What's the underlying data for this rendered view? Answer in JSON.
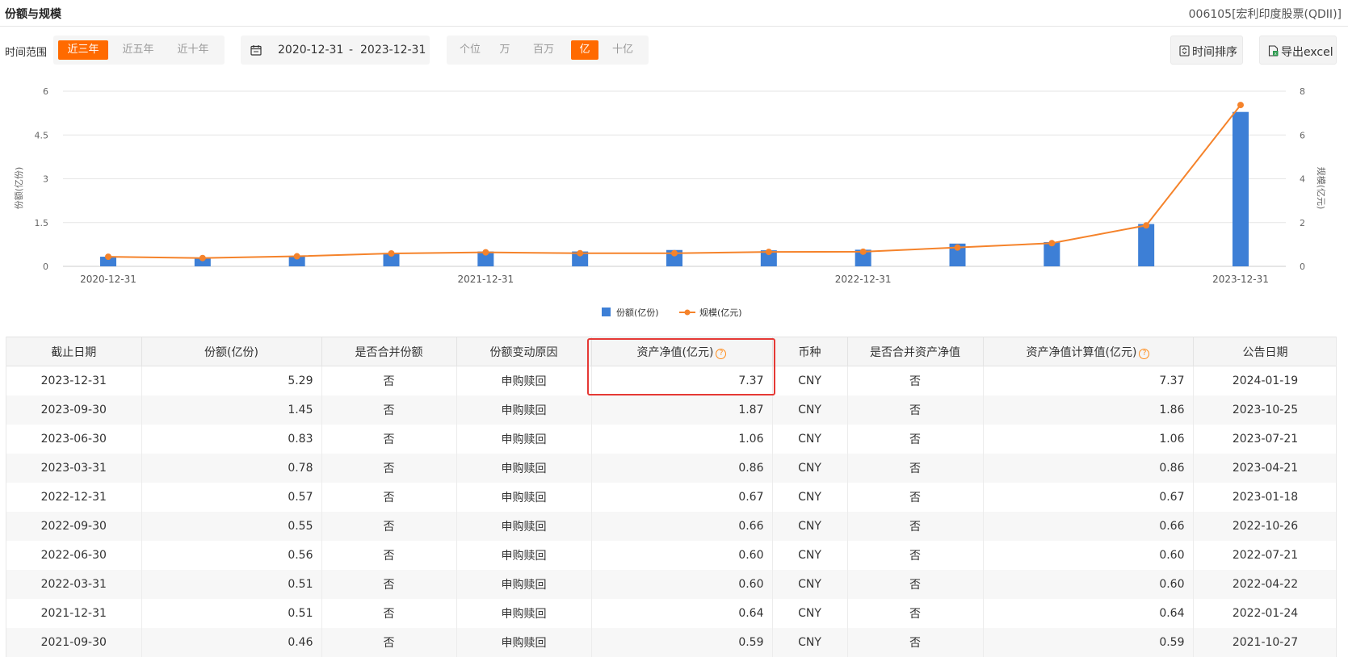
{
  "header": {
    "title": "份额与规模",
    "fund": "006105[宏利印度股票(QDII)]"
  },
  "toolbar": {
    "range_label": "时间范围",
    "range_tabs": [
      {
        "label": "近三年",
        "active": true
      },
      {
        "label": "近五年",
        "active": false
      },
      {
        "label": "近十年",
        "active": false
      }
    ],
    "date_start": "2020-12-31",
    "date_sep": "-",
    "date_end": "2023-12-31",
    "unit_tabs": [
      {
        "label": "个位",
        "active": false
      },
      {
        "label": "万",
        "active": false
      },
      {
        "label": "百万",
        "active": false
      },
      {
        "label": "亿",
        "active": true
      },
      {
        "label": "十亿",
        "active": false
      }
    ],
    "sort_label": "时间排序",
    "export_label": "导出excel",
    "accent_color": "#ff6a00"
  },
  "chart_data": {
    "type": "bar",
    "categories": [
      "2020-12-31",
      "2021-03-31",
      "2021-06-30",
      "2021-09-30",
      "2021-12-31",
      "2022-03-31",
      "2022-06-30",
      "2022-09-30",
      "2022-12-31",
      "2023-03-31",
      "2023-06-30",
      "2023-09-30",
      "2023-12-31"
    ],
    "x_tick_labels": [
      "2020-12-31",
      "2021-12-31",
      "2022-12-31",
      "2023-12-31"
    ],
    "y_left": {
      "label": "份额(亿份)",
      "range": [
        0,
        6
      ],
      "ticks": [
        "0",
        "1.5",
        "3",
        "4.5",
        "6"
      ]
    },
    "y_right": {
      "label": "规模(亿元)",
      "range": [
        0,
        8
      ],
      "ticks": [
        "0",
        "2",
        "4",
        "6",
        "8"
      ]
    },
    "series": [
      {
        "name": "份额(亿份)",
        "kind": "bar",
        "axis": "left",
        "color": "#3d7fd6",
        "values": [
          0.33,
          0.29,
          0.34,
          0.46,
          0.51,
          0.51,
          0.56,
          0.55,
          0.57,
          0.78,
          0.83,
          1.45,
          5.29
        ]
      },
      {
        "name": "规模(亿元)",
        "kind": "line",
        "axis": "right",
        "color": "#f5832b",
        "values": [
          0.44,
          0.38,
          0.46,
          0.59,
          0.64,
          0.6,
          0.6,
          0.66,
          0.67,
          0.86,
          1.06,
          1.87,
          7.37
        ]
      }
    ],
    "legend_position": "bottom",
    "grid": true
  },
  "table": {
    "columns": [
      "截止日期",
      "份额(亿份)",
      "是否合并份额",
      "份额变动原因",
      "资产净值(亿元)",
      "币种",
      "是否合并资产净值",
      "资产净值计算值(亿元)",
      "公告日期"
    ],
    "help_icon": "?",
    "rows": [
      [
        "2023-12-31",
        "5.29",
        "否",
        "申购赎回",
        "7.37",
        "CNY",
        "否",
        "7.37",
        "2024-01-19"
      ],
      [
        "2023-09-30",
        "1.45",
        "否",
        "申购赎回",
        "1.87",
        "CNY",
        "否",
        "1.86",
        "2023-10-25"
      ],
      [
        "2023-06-30",
        "0.83",
        "否",
        "申购赎回",
        "1.06",
        "CNY",
        "否",
        "1.06",
        "2023-07-21"
      ],
      [
        "2023-03-31",
        "0.78",
        "否",
        "申购赎回",
        "0.86",
        "CNY",
        "否",
        "0.86",
        "2023-04-21"
      ],
      [
        "2022-12-31",
        "0.57",
        "否",
        "申购赎回",
        "0.67",
        "CNY",
        "否",
        "0.67",
        "2023-01-18"
      ],
      [
        "2022-09-30",
        "0.55",
        "否",
        "申购赎回",
        "0.66",
        "CNY",
        "否",
        "0.66",
        "2022-10-26"
      ],
      [
        "2022-06-30",
        "0.56",
        "否",
        "申购赎回",
        "0.60",
        "CNY",
        "否",
        "0.60",
        "2022-07-21"
      ],
      [
        "2022-03-31",
        "0.51",
        "否",
        "申购赎回",
        "0.60",
        "CNY",
        "否",
        "0.60",
        "2022-04-22"
      ],
      [
        "2021-12-31",
        "0.51",
        "否",
        "申购赎回",
        "0.64",
        "CNY",
        "否",
        "0.64",
        "2022-01-24"
      ],
      [
        "2021-09-30",
        "0.46",
        "否",
        "申购赎回",
        "0.59",
        "CNY",
        "否",
        "0.59",
        "2021-10-27"
      ]
    ]
  }
}
